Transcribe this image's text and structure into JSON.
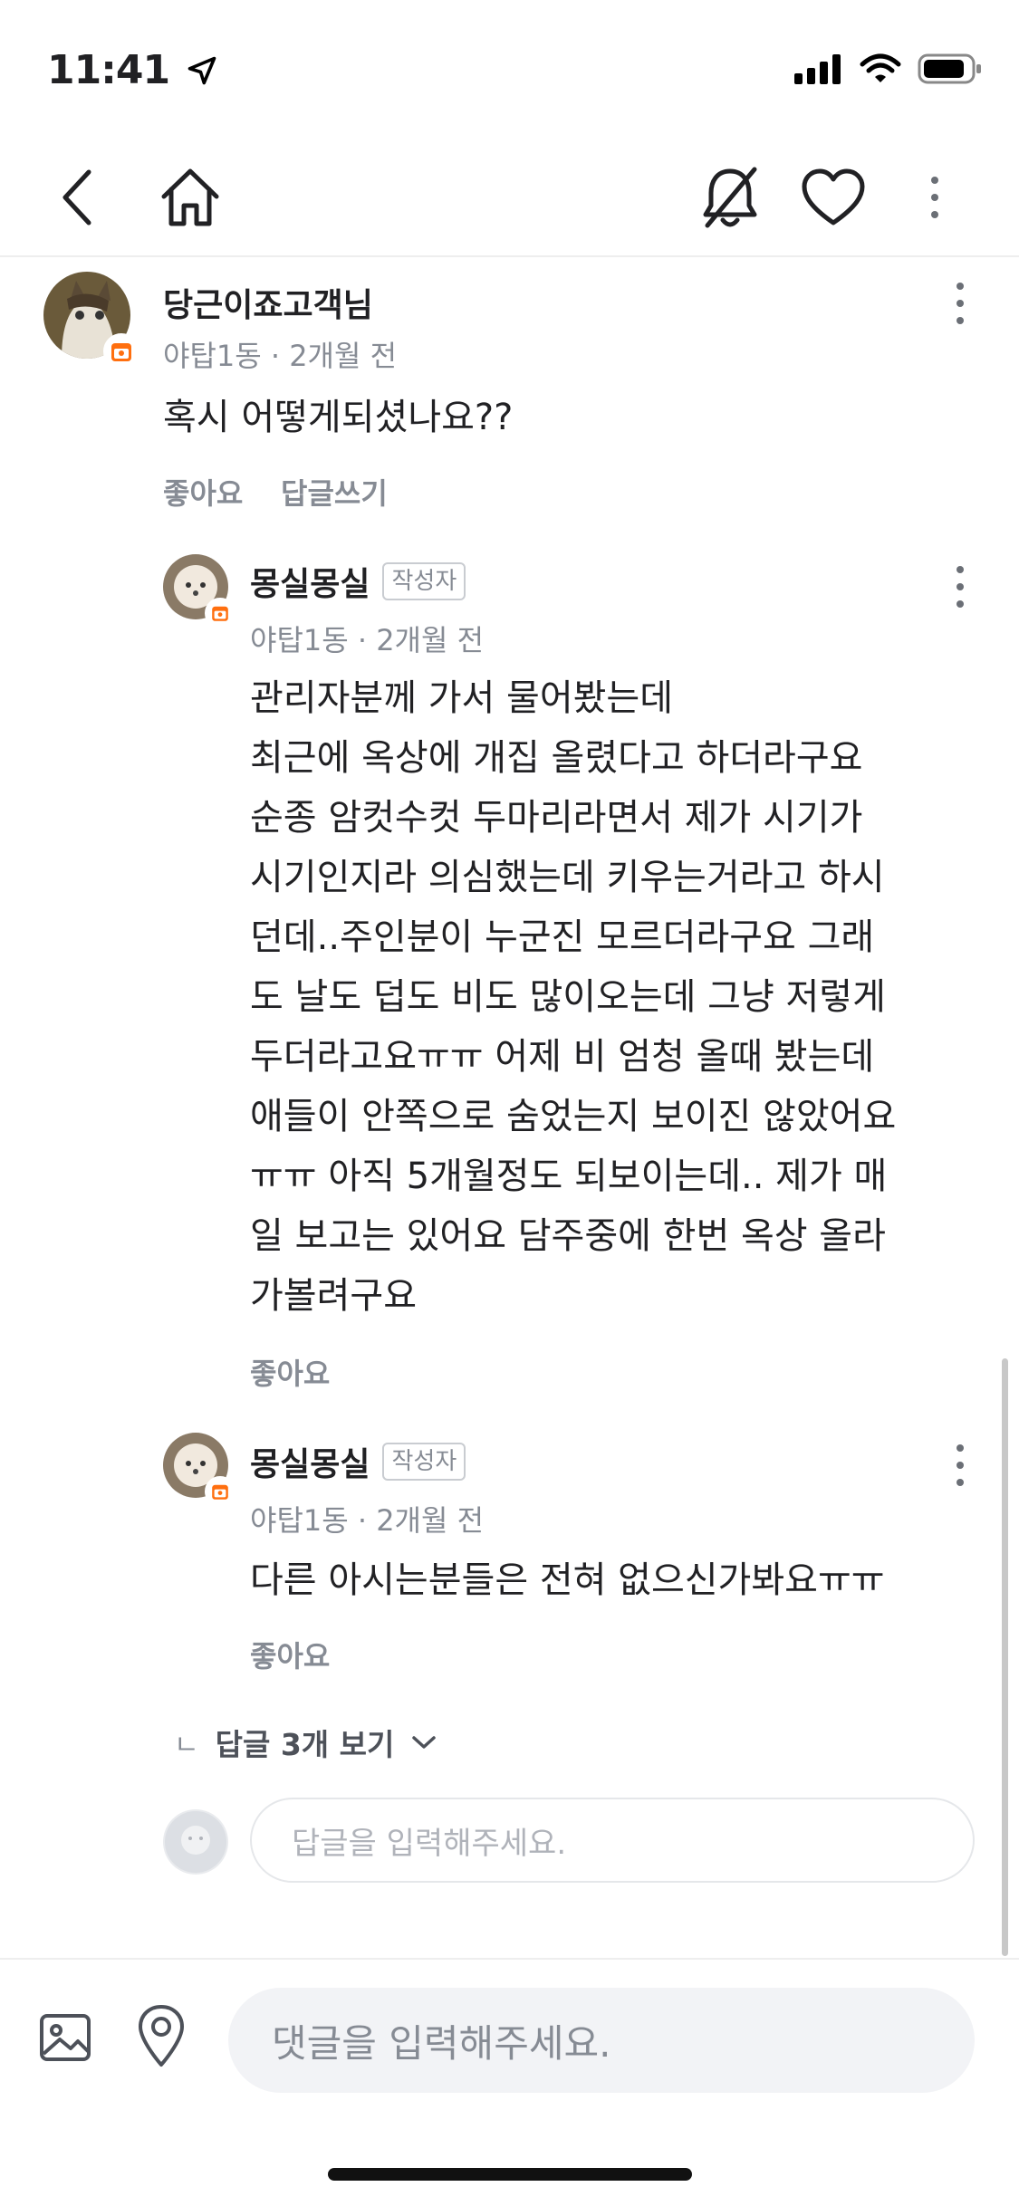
{
  "status_bar": {
    "time": "11:41"
  },
  "comments": [
    {
      "author": "당근이죠고객님",
      "meta": "야탑1동 · 2개월 전",
      "text": "혹시 어떻게되셨나요??",
      "like_label": "좋아요",
      "reply_label": "답글쓰기"
    }
  ],
  "replies": [
    {
      "author": "몽실몽실",
      "badge": "작성자",
      "meta": "야탑1동 · 2개월 전",
      "text": "관리자분께 가서 물어봤는데\n최근에 옥상에 개집 올렸다고 하더라구요\n순종 암컷수컷 두마리라면서 제가 시기가\n시기인지라 의심했는데 키우는거라고 하시\n던데..주인분이 누군진 모르더라구요 그래\n도 날도 덥도 비도 많이오는데 그냥 저렇게\n두더라고요ㅠㅠ 어제 비 엄청 올때 봤는데\n애들이 안쪽으로 숨었는지 보이진 않았어요\nㅠㅠ 아직 5개월정도 되보이는데.. 제가 매\n일 보고는 있어요 담주중에 한번 옥상 올라\n가볼려구요",
      "like_label": "좋아요"
    },
    {
      "author": "몽실몽실",
      "badge": "작성자",
      "meta": "야탑1동 · 2개월 전",
      "text": "다른 아시는분들은 전혀 없으신가봐요ㅠㅠ",
      "like_label": "좋아요"
    }
  ],
  "view_replies": {
    "prefix": "ㄴ",
    "label": "답글 3개 보기"
  },
  "reply_input": {
    "placeholder": "답글을 입력해주세요."
  },
  "comment_input": {
    "placeholder": "댓글을 입력해주세요."
  },
  "icons": {
    "back": "chevron-left-icon",
    "home": "home-icon",
    "notify": "bell-off-icon",
    "like": "heart-icon",
    "more": "more-vertical-icon",
    "image": "image-icon",
    "location": "location-pin-icon"
  },
  "colors": {
    "accent": "#ff6f0f",
    "text": "#212124",
    "muted": "#868b94"
  }
}
